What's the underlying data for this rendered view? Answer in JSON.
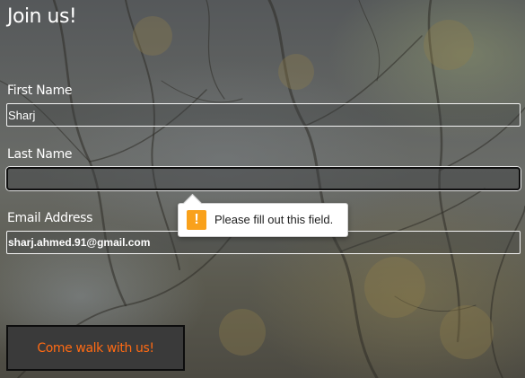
{
  "form": {
    "heading": "Join us!",
    "fields": [
      {
        "label": "First Name",
        "value": "Sharj"
      },
      {
        "label": "Last Name",
        "value": ""
      },
      {
        "label": "Email Address",
        "value": "sharj.ahmed.91@gmail.com"
      }
    ],
    "validation_tooltip": {
      "message": "Please fill out this field.",
      "icon": "warning-icon",
      "icon_color": "#f9a11b"
    },
    "submit_label": "Come walk with us!"
  },
  "colors": {
    "accent": "#ff6a13",
    "label_text": "#ffffff",
    "button_bg": "#3a3a3a"
  }
}
